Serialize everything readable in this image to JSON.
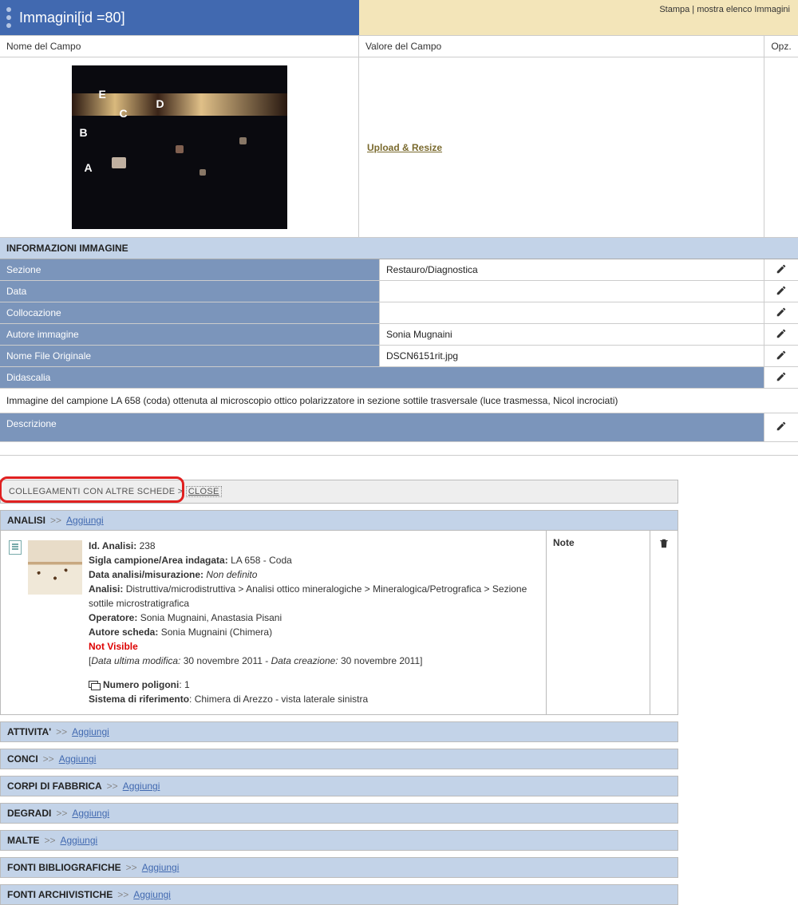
{
  "header": {
    "title": "Immagini[id =80]",
    "links": {
      "stampa": "Stampa",
      "sep": " | ",
      "mostra": "mostra elenco Immagini"
    }
  },
  "columns": {
    "nome": "Nome del Campo",
    "valore": "Valore del Campo",
    "opz": "Opz."
  },
  "upload": "Upload & Resize",
  "image_labels": {
    "A": "A",
    "B": "B",
    "C": "C",
    "D": "D",
    "E": "E"
  },
  "section_info": "INFORMAZIONI IMMAGINE",
  "fields": {
    "sezione": {
      "label": "Sezione",
      "value": "Restauro/Diagnostica"
    },
    "data": {
      "label": "Data",
      "value": ""
    },
    "collocazione": {
      "label": "Collocazione",
      "value": ""
    },
    "autore": {
      "label": "Autore immagine",
      "value": "Sonia Mugnaini"
    },
    "nomefile": {
      "label": "Nome File Originale",
      "value": "DSCN6151rit.jpg"
    },
    "didascalia": {
      "label": "Didascalia",
      "text": "Immagine del campione LA 658 (coda) ottenuta al microscopio ottico polarizzatore in sezione sottile trasversale (luce trasmessa, Nicol incrociati)"
    },
    "descrizione": {
      "label": "Descrizione",
      "value": ""
    }
  },
  "links_header": {
    "title": "COLLEGAMENTI CON ALTRE SCHEDE",
    "sep": " > ",
    "close": "CLOSE"
  },
  "analisi": {
    "title": "ANALISI",
    "aggiungi": "Aggiungi",
    "note": "Note",
    "card": {
      "id_label": "Id. Analisi:",
      "id_val": "238",
      "sigla_label": "Sigla campione/Area indagata:",
      "sigla_val": "LA 658 - Coda",
      "data_label": "Data analisi/misurazione:",
      "data_val": "Non definito",
      "analisi_label": "Analisi:",
      "analisi_val": "Distruttiva/microdistruttiva > Analisi ottico mineralogiche > Mineralogica/Petrografica > Sezione sottile microstratigrafica",
      "op_label": "Operatore:",
      "op_val": "Sonia Mugnaini, Anastasia Pisani",
      "autore_label": "Autore scheda:",
      "autore_val": "Sonia Mugnaini (Chimera)",
      "nv": "Not Visible",
      "meta_open": "[",
      "meta_mod_label": "Data ultima modifica:",
      "meta_mod_val": " 30 novembre 2011 - ",
      "meta_cre_label": "Data creazione:",
      "meta_cre_val": " 30 novembre 2011",
      "meta_close": "]",
      "poly_label": "Numero poligoni",
      "poly_sep": ": ",
      "poly_val": "1",
      "sist_label": "Sistema di riferimento",
      "sist_sep": ": ",
      "sist_val": "Chimera di Arezzo - vista laterale sinistra"
    }
  },
  "subs": {
    "attivita": "ATTIVITA'",
    "conci": "CONCI",
    "corpi": "CORPI DI FABBRICA",
    "degradi": "DEGRADI",
    "malte": "MALTE",
    "fonti_bib": "FONTI BIBLIOGRAFICHE",
    "fonti_arch": "FONTI ARCHIVISTICHE",
    "aggiungi": "Aggiungi",
    "arrow": ">>"
  }
}
